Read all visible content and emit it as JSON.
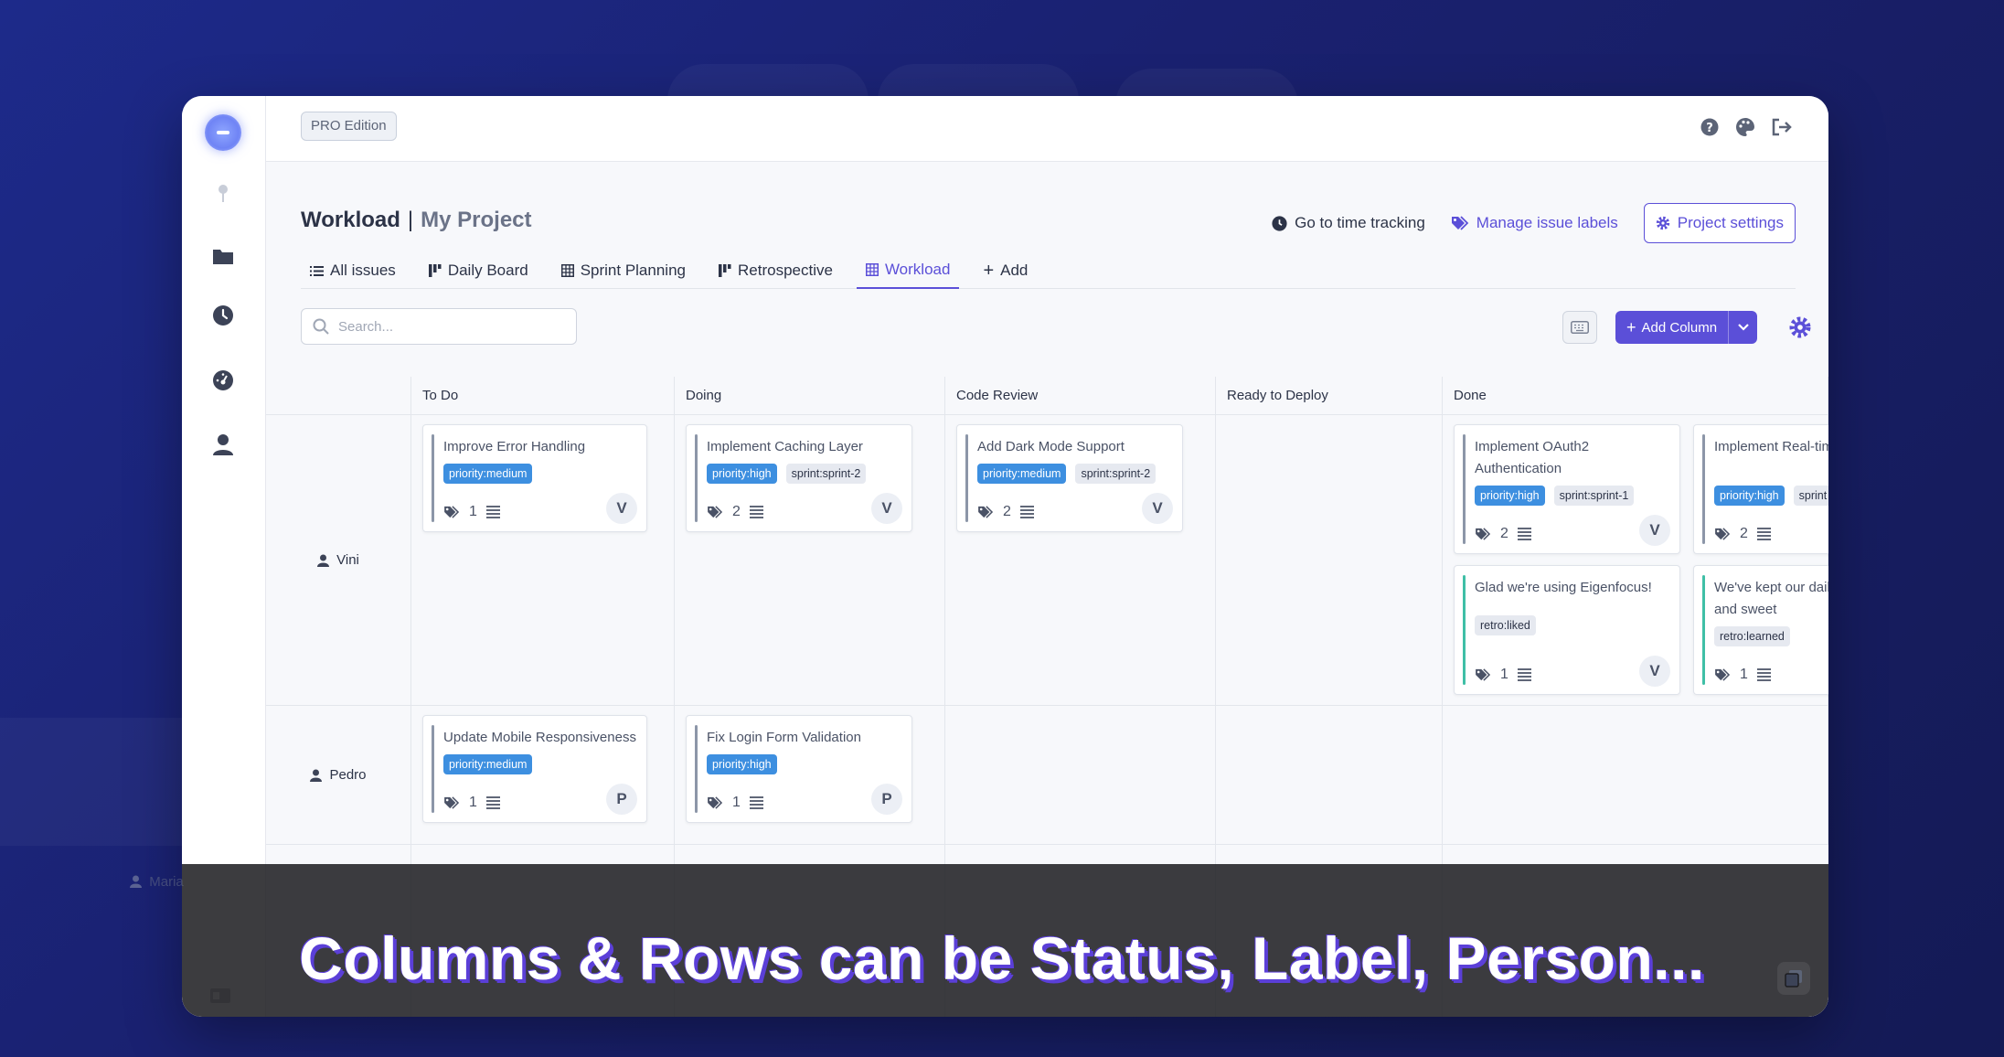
{
  "header": {
    "edition_badge": "PRO Edition"
  },
  "page": {
    "title": "Workload",
    "separator": "|",
    "project": "My Project"
  },
  "actions": {
    "time_tracking": "Go to time tracking",
    "manage_labels": "Manage issue labels",
    "project_settings": "Project settings"
  },
  "tabs": [
    {
      "label": "All issues"
    },
    {
      "label": "Daily Board"
    },
    {
      "label": "Sprint Planning"
    },
    {
      "label": "Retrospective"
    },
    {
      "label": "Workload",
      "active": true
    },
    {
      "label": "Add"
    }
  ],
  "toolbar": {
    "search_placeholder": "Search...",
    "add_column": "Add Column"
  },
  "columns": [
    "To Do",
    "Doing",
    "Code Review",
    "Ready to Deploy",
    "Done"
  ],
  "rows": [
    "Vini",
    "Pedro",
    "Maria"
  ],
  "cards": {
    "vini_todo": {
      "title": "Improve Error Handling",
      "tags": [
        "priority:medium"
      ],
      "count": "1",
      "avatar": "V"
    },
    "vini_doing": {
      "title": "Implement Caching Layer",
      "tags": [
        "priority:high",
        "sprint:sprint-2"
      ],
      "count": "2",
      "avatar": "V"
    },
    "vini_review": {
      "title": "Add Dark Mode Support",
      "tags": [
        "priority:medium",
        "sprint:sprint-2"
      ],
      "count": "2",
      "avatar": "V"
    },
    "vini_done1": {
      "title": "Implement OAuth2 Authentication",
      "tags": [
        "priority:high",
        "sprint:sprint-1"
      ],
      "count": "2",
      "avatar": "V"
    },
    "vini_done2": {
      "title": "Implement Real-time Notifications",
      "tags": [
        "priority:high",
        "sprint"
      ],
      "count": "2"
    },
    "vini_done3": {
      "title": "Glad we're using Eigenfocus!",
      "tags": [
        "retro:liked"
      ],
      "count": "1",
      "avatar": "V"
    },
    "vini_done4": {
      "title": "We've kept our daily short and sweet",
      "tags": [
        "retro:learned"
      ],
      "count": "1"
    },
    "pedro_todo": {
      "title": "Update Mobile Responsiveness",
      "tags": [
        "priority:medium"
      ],
      "count": "1",
      "avatar": "P"
    },
    "pedro_doing": {
      "title": "Fix Login Form Validation",
      "tags": [
        "priority:high"
      ],
      "count": "1",
      "avatar": "P"
    }
  },
  "caption": "Columns & Rows can be Status, Label, Person...",
  "colors": {
    "accent": "#5b4fd8",
    "tag_blue": "#3d8fe0",
    "retro_green": "#3fbfa6"
  }
}
